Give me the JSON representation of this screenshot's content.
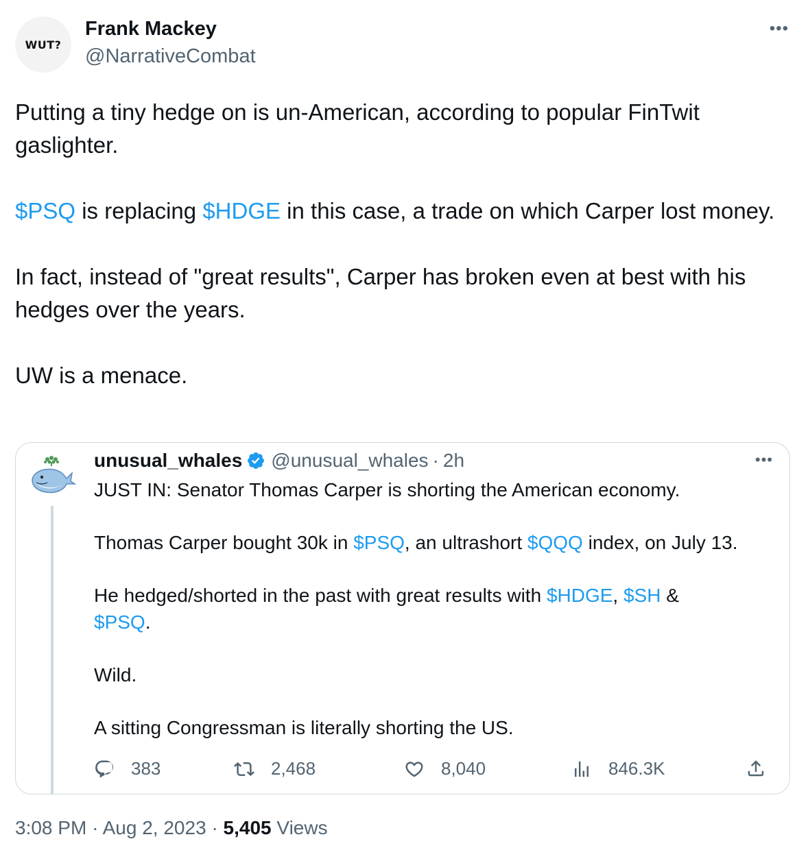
{
  "author": {
    "avatar_text": "WUT?",
    "name": "Frank Mackey",
    "handle": "@NarrativeCombat"
  },
  "tweet": {
    "p1": "Putting a tiny hedge on is un-American, according to popular FinTwit gaslighter.",
    "p2_cashtag1": "$PSQ",
    "p2_mid": " is replacing ",
    "p2_cashtag2": "$HDGE",
    "p2_end": " in this case, a trade on which Carper lost money.",
    "p3": "In fact, instead of \"great results\", Carper has broken even at best with his hedges over the years.",
    "p4": "UW is a menace."
  },
  "quote": {
    "name": "unusual_whales",
    "handle": "@unusual_whales",
    "separator": "·",
    "time": "2h",
    "line1": "JUST IN: Senator Thomas Carper is shorting the American economy.",
    "line2_a": "Thomas Carper bought 30k in ",
    "line2_tag1": "$PSQ",
    "line2_b": ", an ultrashort ",
    "line2_tag2": "$QQQ",
    "line2_c": " index, on July 13.",
    "line3_a": "He hedged/shorted in the past with great results with ",
    "line3_tag1": "$HDGE",
    "line3_b": ", ",
    "line3_tag2": "$SH",
    "line3_c": " & ",
    "line3_tag3": "$PSQ",
    "line3_d": ".",
    "line4": "Wild.",
    "line5": "A sitting Congressman is literally shorting the US.",
    "stats": {
      "replies": "383",
      "retweets": "2,468",
      "likes": "8,040",
      "views": "846.3K"
    },
    "icons": {
      "reply": "reply-icon",
      "retweet": "retweet-icon",
      "like": "like-icon",
      "views": "views-icon",
      "share": "share-icon",
      "verified": "verified-badge-icon",
      "whale": "whale-avatar-icon"
    }
  },
  "footer": {
    "time": "3:08 PM",
    "dot1": "·",
    "date": "Aug 2, 2023",
    "dot2": "·",
    "views_count": "5,405",
    "views_label": "Views"
  },
  "colors": {
    "link": "#1d9bf0",
    "text": "#0f1419",
    "muted": "#536471",
    "border": "#cfd9de",
    "verified": "#1d9bf0"
  }
}
